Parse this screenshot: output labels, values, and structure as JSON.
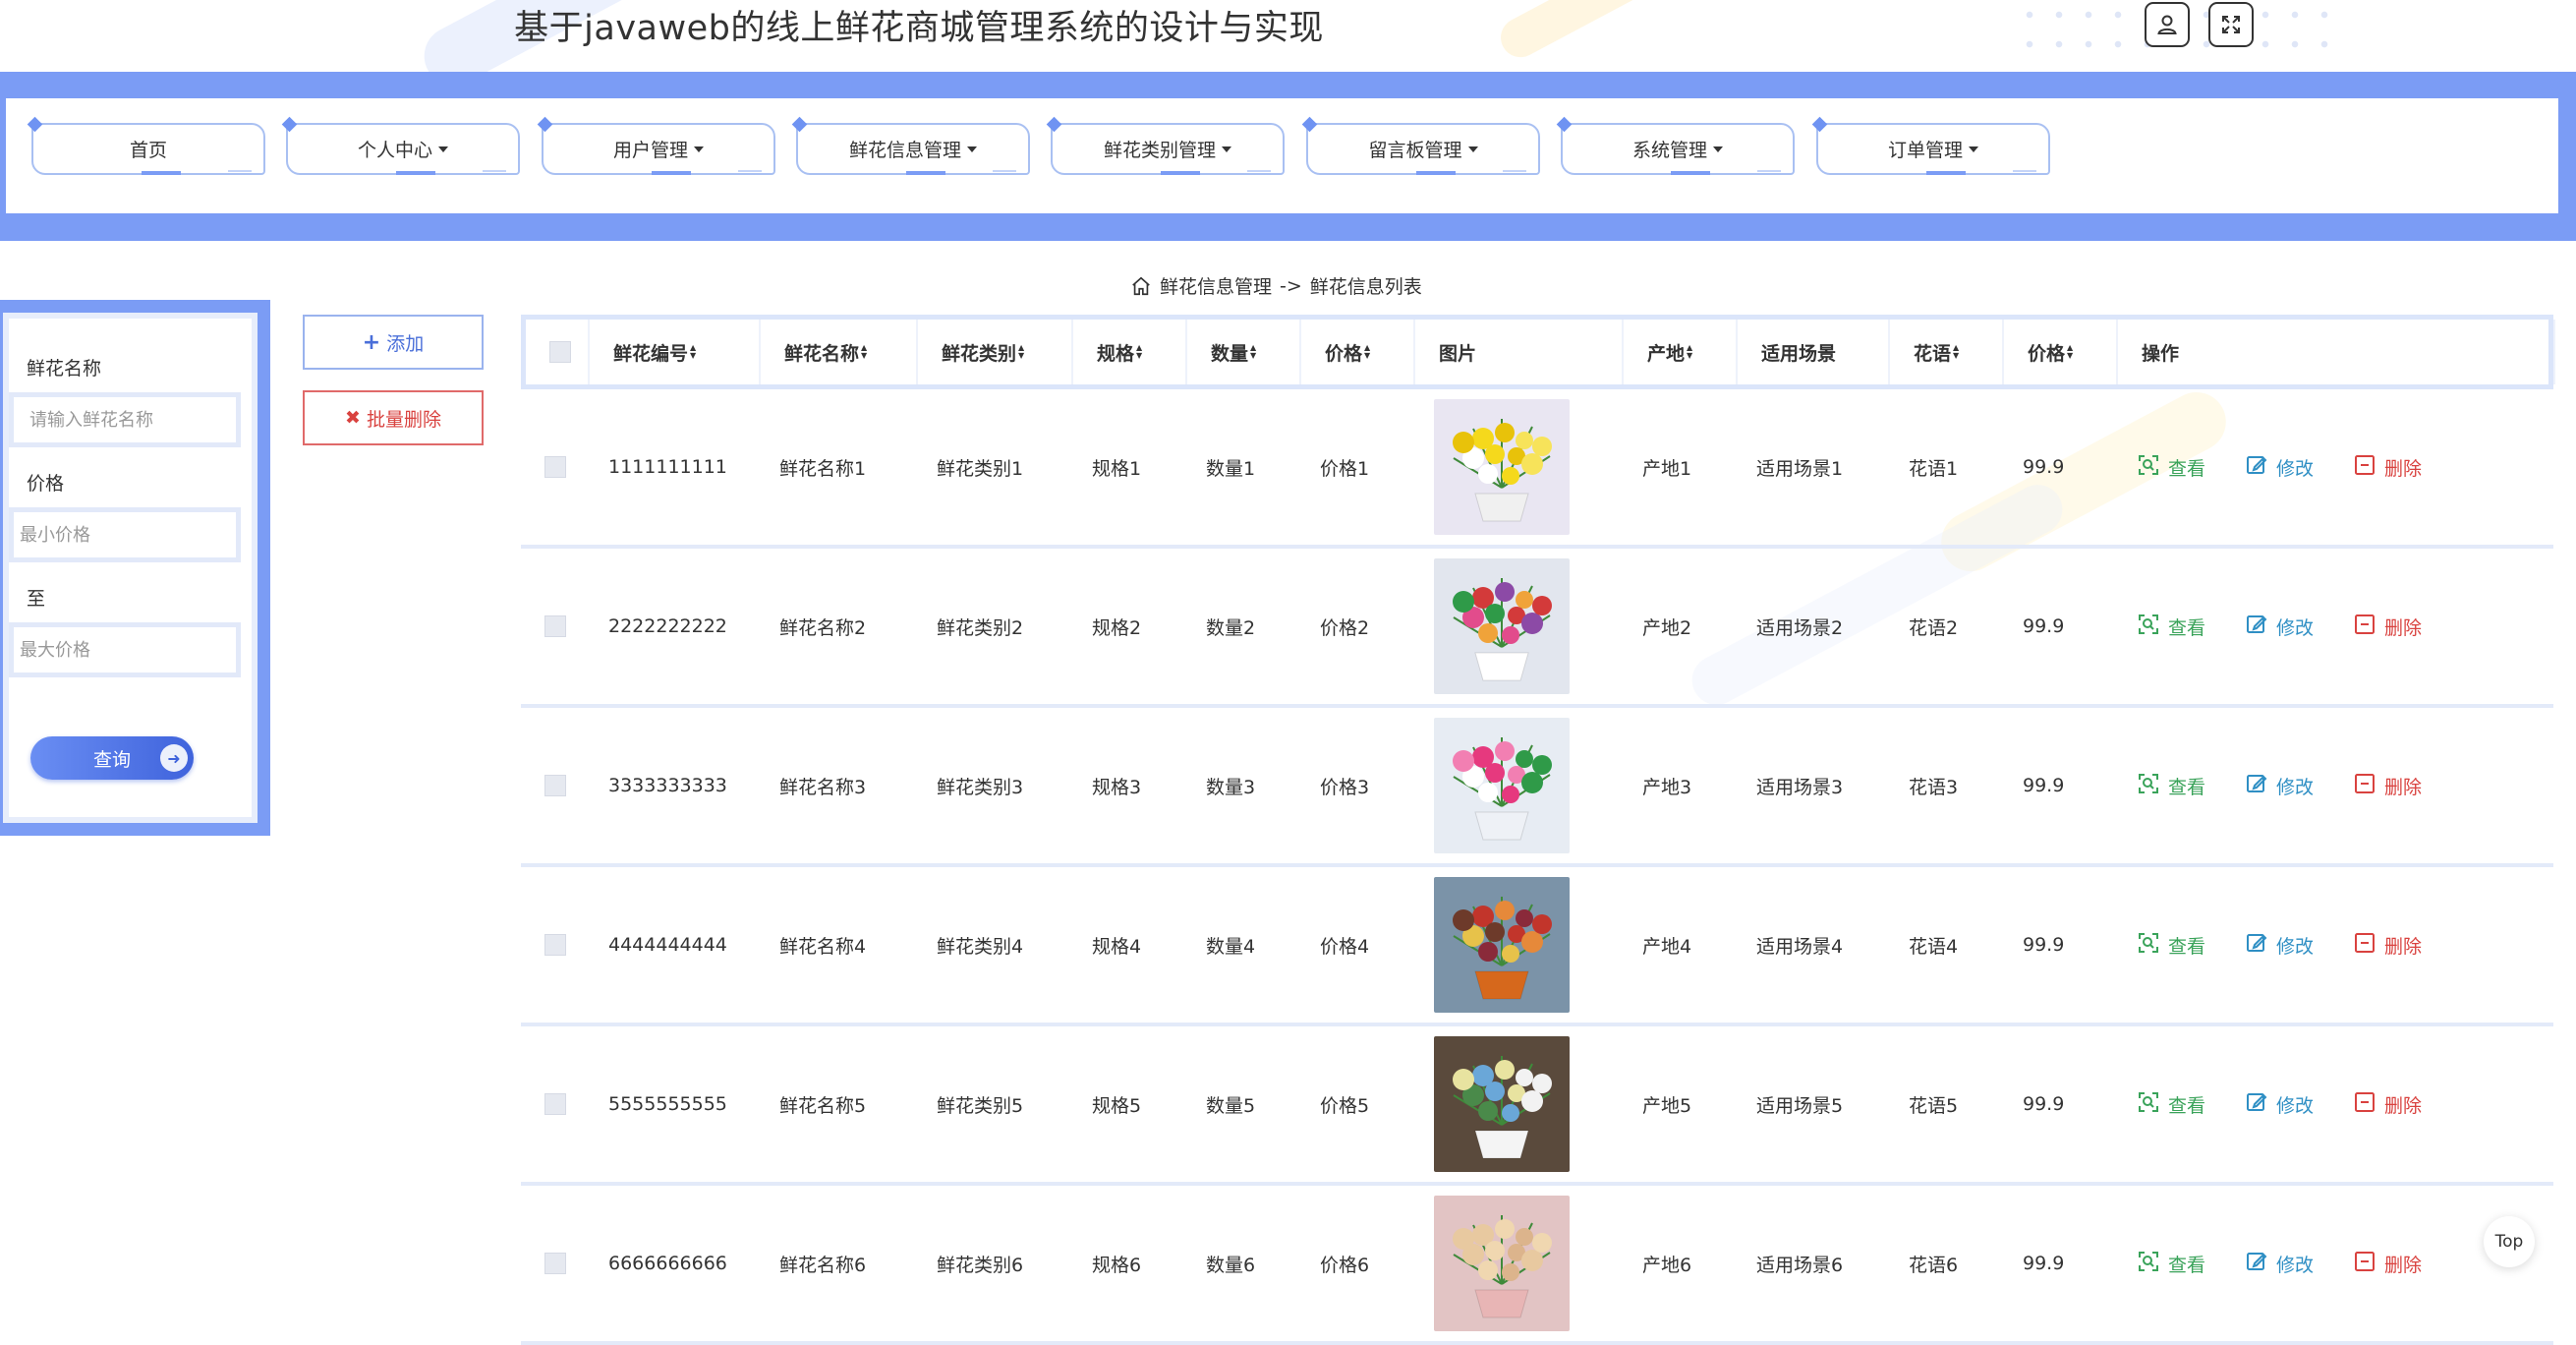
{
  "header": {
    "title": "基于javaweb的线上鲜花商城管理系统的设计与实现",
    "icons": [
      "user-icon",
      "fullscreen-icon"
    ]
  },
  "nav": {
    "items": [
      {
        "label": "首页",
        "dropdown": false
      },
      {
        "label": "个人中心",
        "dropdown": true
      },
      {
        "label": "用户管理",
        "dropdown": true
      },
      {
        "label": "鲜花信息管理",
        "dropdown": true
      },
      {
        "label": "鲜花类别管理",
        "dropdown": true
      },
      {
        "label": "留言板管理",
        "dropdown": true
      },
      {
        "label": "系统管理",
        "dropdown": true
      },
      {
        "label": "订单管理",
        "dropdown": true
      }
    ]
  },
  "breadcrumb": {
    "section": "鲜花信息管理",
    "separator": "->",
    "page": "鲜花信息列表"
  },
  "search": {
    "name_label": "鲜花名称",
    "name_placeholder": "请输入鲜花名称",
    "price_label": "价格",
    "min_placeholder": "最小价格",
    "to_label": "至",
    "max_placeholder": "最大价格",
    "query_label": "查询"
  },
  "actions": {
    "add_label": "添加",
    "batch_delete_label": "批量删除"
  },
  "table": {
    "headers": [
      "鲜花编号",
      "鲜花名称",
      "鲜花类别",
      "规格",
      "数量",
      "价格",
      "图片",
      "产地",
      "适用场景",
      "花语",
      "价格",
      "操作"
    ],
    "sortable": [
      true,
      true,
      true,
      true,
      true,
      true,
      false,
      true,
      false,
      true,
      true,
      false
    ],
    "row_actions": {
      "view": "查看",
      "edit": "修改",
      "delete": "删除"
    },
    "rows": [
      {
        "id": "1111111111",
        "name": "鲜花名称1",
        "category": "鲜花类别1",
        "spec": "规格1",
        "qty": "数量1",
        "price": "价格1",
        "origin": "产地1",
        "scene": "适用场景1",
        "language": "花语1",
        "price2": "99.9"
      },
      {
        "id": "2222222222",
        "name": "鲜花名称2",
        "category": "鲜花类别2",
        "spec": "规格2",
        "qty": "数量2",
        "price": "价格2",
        "origin": "产地2",
        "scene": "适用场景2",
        "language": "花语2",
        "price2": "99.9"
      },
      {
        "id": "3333333333",
        "name": "鲜花名称3",
        "category": "鲜花类别3",
        "spec": "规格3",
        "qty": "数量3",
        "price": "价格3",
        "origin": "产地3",
        "scene": "适用场景3",
        "language": "花语3",
        "price2": "99.9"
      },
      {
        "id": "4444444444",
        "name": "鲜花名称4",
        "category": "鲜花类别4",
        "spec": "规格4",
        "qty": "数量4",
        "price": "价格4",
        "origin": "产地4",
        "scene": "适用场景4",
        "language": "花语4",
        "price2": "99.9"
      },
      {
        "id": "5555555555",
        "name": "鲜花名称5",
        "category": "鲜花类别5",
        "spec": "规格5",
        "qty": "数量5",
        "price": "价格5",
        "origin": "产地5",
        "scene": "适用场景5",
        "language": "花语5",
        "price2": "99.9"
      },
      {
        "id": "6666666666",
        "name": "鲜花名称6",
        "category": "鲜花类别6",
        "spec": "规格6",
        "qty": "数量6",
        "price": "价格6",
        "origin": "产地6",
        "scene": "适用场景6",
        "language": "花语6",
        "price2": "99.9"
      }
    ]
  },
  "scroll_top_label": "Top",
  "colors": {
    "accent": "#7b9cf5",
    "view": "#3aa35a",
    "edit": "#2f8fc4",
    "delete": "#d9423f"
  }
}
